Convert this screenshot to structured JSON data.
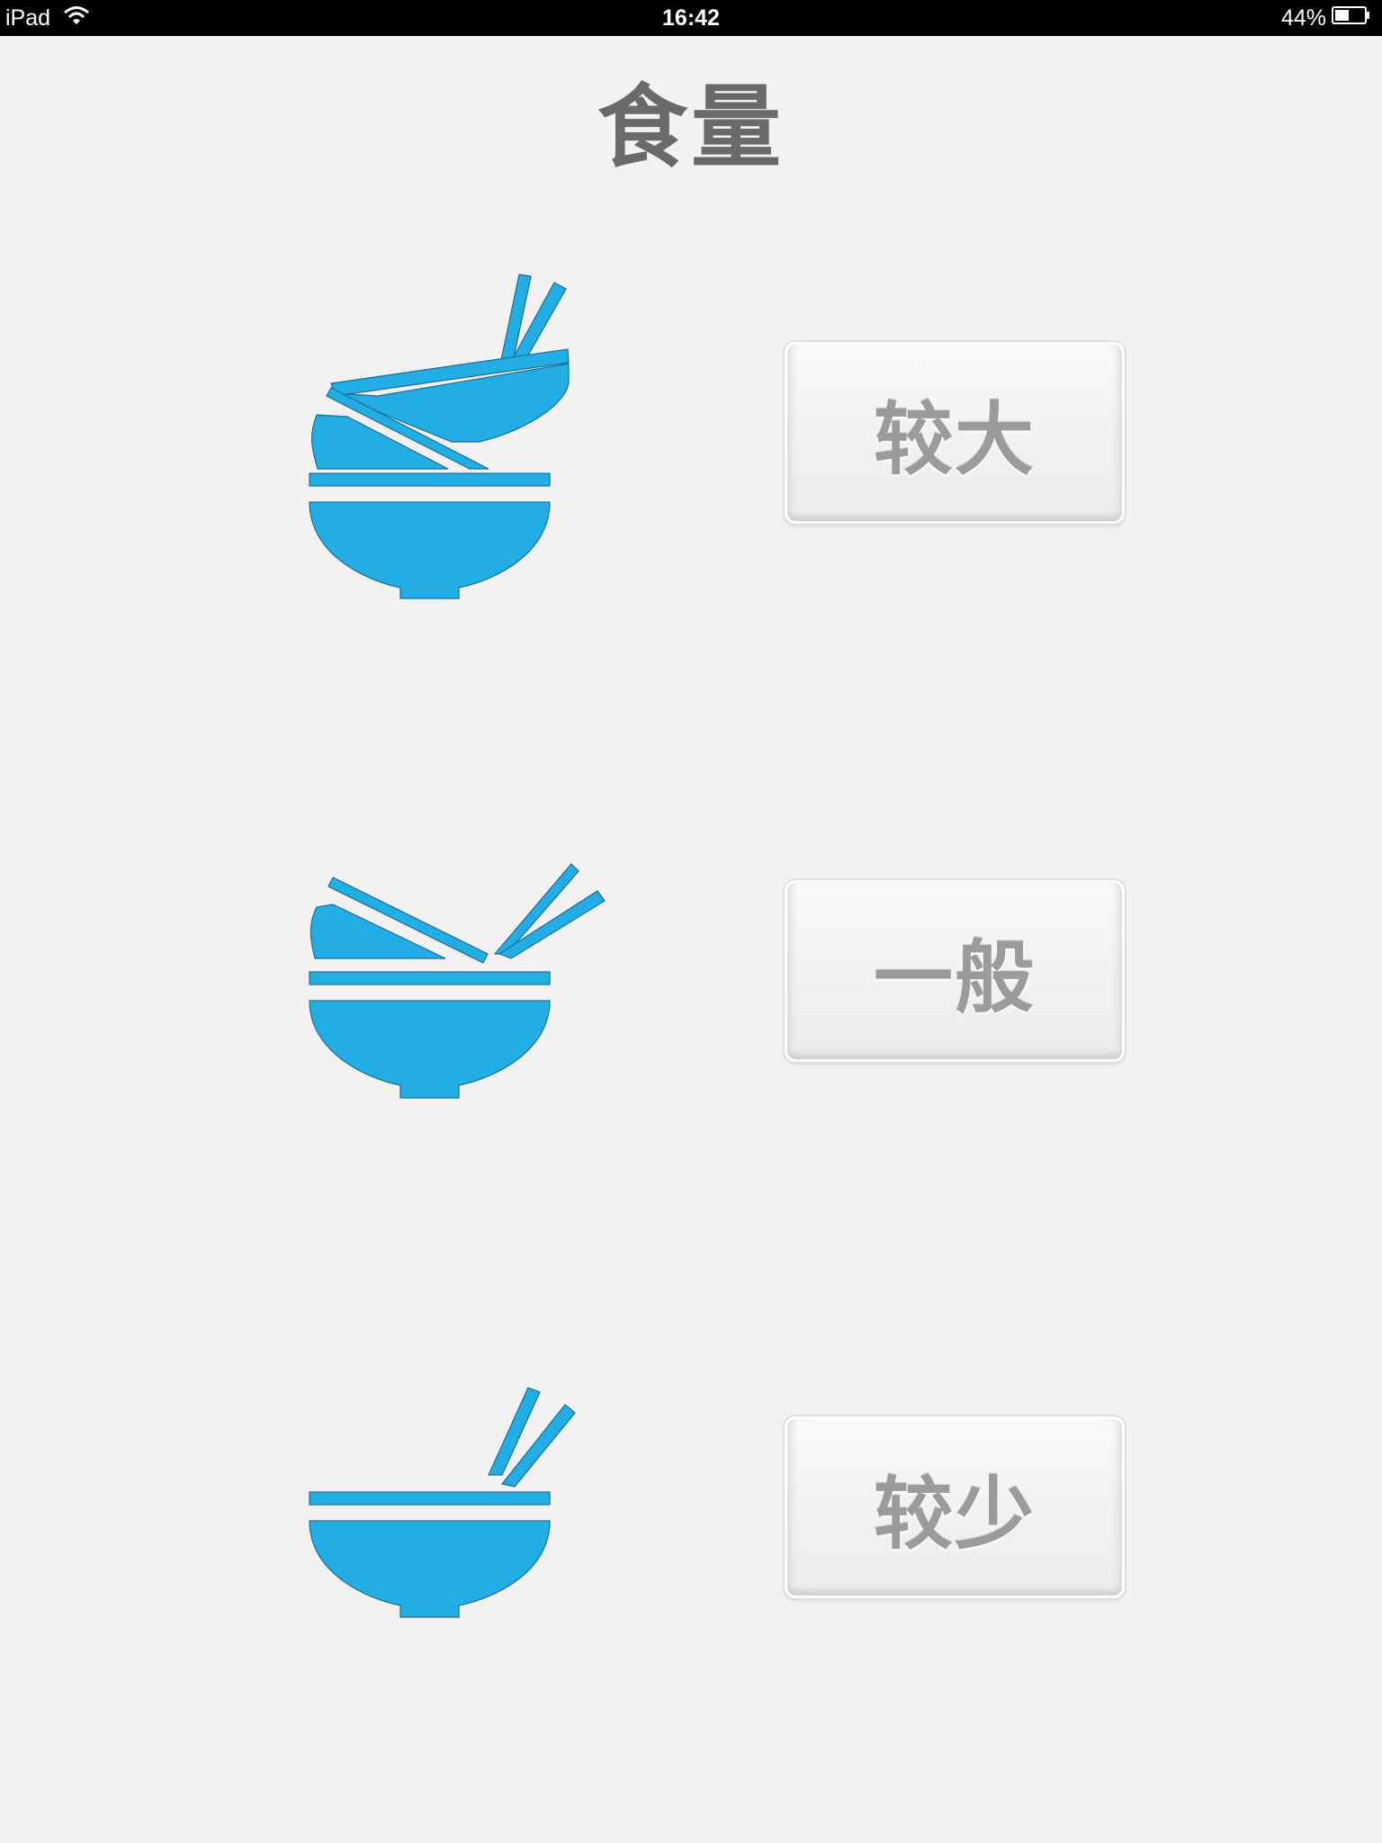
{
  "status_bar": {
    "device": "iPad",
    "time": "16:42",
    "battery": "44%",
    "icons": [
      "wifi-icon",
      "battery-icon"
    ]
  },
  "title": "食量",
  "accent_color": "#22ADE4",
  "options": [
    {
      "label": "较大",
      "icon": "full-bowl-icon"
    },
    {
      "label": "一般",
      "icon": "half-bowl-icon"
    },
    {
      "label": "较少",
      "icon": "empty-bowl-icon"
    }
  ]
}
